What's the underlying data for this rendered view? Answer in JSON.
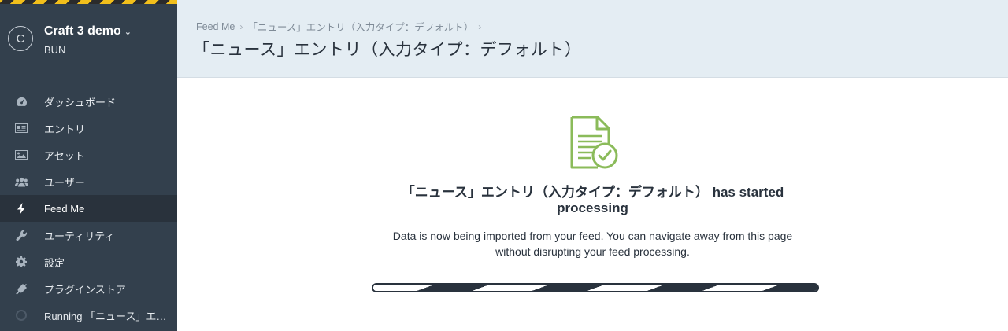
{
  "site": {
    "initial": "C",
    "name": "Craft 3 demo",
    "user": "BUN"
  },
  "nav": [
    {
      "label": "ダッシュボード",
      "icon": "gauge-icon"
    },
    {
      "label": "エントリ",
      "icon": "newspaper-icon"
    },
    {
      "label": "アセット",
      "icon": "image-icon"
    },
    {
      "label": "ユーザー",
      "icon": "users-icon"
    },
    {
      "label": "Feed Me",
      "icon": "bolt-icon",
      "active": true
    },
    {
      "label": "ユーティリティ",
      "icon": "wrench-icon"
    },
    {
      "label": "設定",
      "icon": "gear-icon"
    },
    {
      "label": "プラグインストア",
      "icon": "plug-icon"
    },
    {
      "label": "Running 「ニュース」エ…",
      "icon": "spinner-icon"
    }
  ],
  "header": {
    "breadcrumb": [
      "Feed Me",
      "「ニュース」エントリ（入力タイプ：デフォルト）"
    ],
    "title": "「ニュース」エントリ（入力タイプ：デフォルト）"
  },
  "main": {
    "message_title_line1": "「ニュース」エントリ（入力タイプ：デフォルト） has started",
    "message_title_line2": "processing",
    "message_text_line1": "Data is now being imported from your feed. You can navigate away from this page",
    "message_text_line2": "without disrupting your feed processing."
  },
  "colors": {
    "sidebar": "#33404d",
    "header": "#e4edf3",
    "accent_green": "#8bbb5a",
    "stripe_yellow": "#f2bf1b"
  }
}
